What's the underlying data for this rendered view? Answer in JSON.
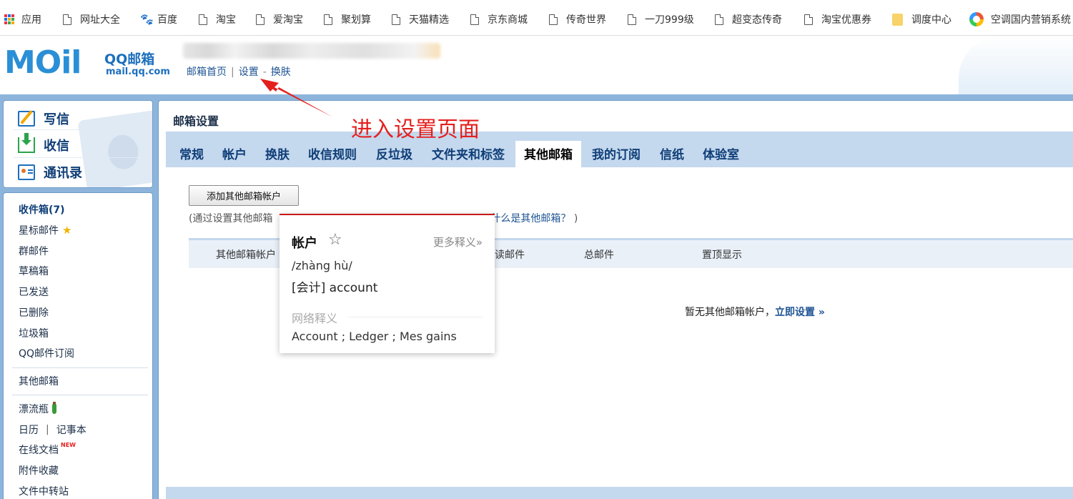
{
  "bookmarks": {
    "items": [
      "应用",
      "网址大全",
      "百度",
      "淘宝",
      "爱淘宝",
      "聚划算",
      "天猫精选",
      "京东商城",
      "传奇世界",
      "一刀999级",
      "超变态传奇",
      "淘宝优惠券",
      "调度中心",
      "空调国内营销系统"
    ]
  },
  "header": {
    "logo_text": "MOil",
    "logo_brand": "QQ邮箱",
    "logo_url": "mail.qq.com",
    "links": {
      "home": "邮箱首页",
      "sep1": "|",
      "settings": "设置",
      "sep2": "-",
      "skin": "换肤"
    }
  },
  "annotation": {
    "text": "进入设置页面",
    "color": "#e4201e"
  },
  "sidebar": {
    "actions": [
      "写信",
      "收信",
      "通讯录"
    ],
    "nav": {
      "inbox": "收件箱(7)",
      "starred": "星标邮件",
      "group": "群邮件",
      "drafts": "草稿箱",
      "sent": "已发送",
      "deleted": "已删除",
      "spam": "垃圾箱",
      "subscriptions": "QQ邮件订阅",
      "other_mailbox": "其他邮箱",
      "bottle": "漂流瓶",
      "calendar": "日历",
      "calendar_sep": "|",
      "notes": "记事本",
      "docs": "在线文档",
      "docs_badge": "NEW",
      "attachments": "附件收藏",
      "transfer": "文件中转站"
    }
  },
  "main": {
    "title": "邮箱设置",
    "tabs": [
      "常规",
      "帐户",
      "换肤",
      "收信规则",
      "反垃圾",
      "文件夹和标签",
      "其他邮箱",
      "我的订阅",
      "信纸",
      "体验室"
    ],
    "active_tab": "其他邮箱",
    "add_button": "添加其他邮箱帐户",
    "desc_prefix": "(通过设置其他邮箱",
    "desc_link": "什么是其他邮箱？",
    "desc_suffix": ")",
    "table_headers": [
      "其他邮箱帐户",
      "未读邮件",
      "总邮件",
      "置顶显示"
    ],
    "empty_text": "暂无其他邮箱帐户，",
    "empty_link": "立即设置 »"
  },
  "popup": {
    "word": "帐户",
    "star_icon": "star-outline-icon",
    "more": "更多释义»",
    "phonetic": "/zhàng hù/",
    "definition": "[会计] account",
    "net_label": "网络释义",
    "net_definition": "Account ; Ledger ; Mes gains"
  }
}
